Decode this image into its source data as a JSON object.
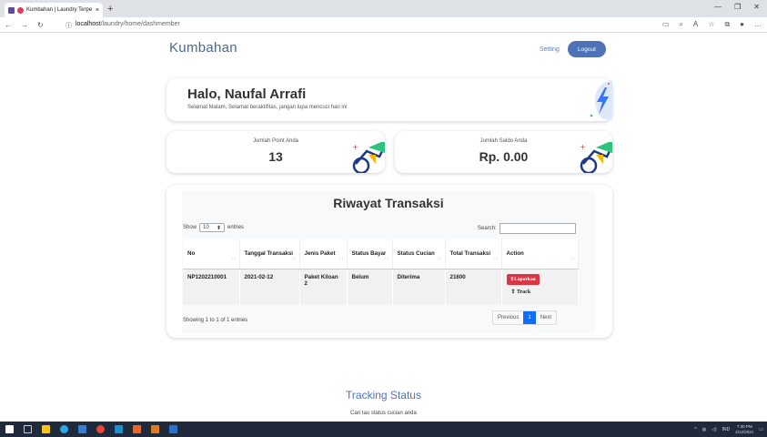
{
  "browser": {
    "tab_title": "Kumbahan | Laundry Terpe",
    "tab_close": "×",
    "new_tab": "+",
    "url_host": "localhost",
    "url_path": "/laundry/home/dashmember"
  },
  "header": {
    "brand": "Kumbahan",
    "setting_label": "Setting",
    "logout_label": "Logout"
  },
  "greeting": {
    "title": "Halo, Naufal Arrafi",
    "subtitle": "Selamat Malam, Selamat beraktifitas, jangan lupa mencuci hari ini"
  },
  "stats": [
    {
      "label": "Jumlah Point Anda",
      "value": "13"
    },
    {
      "label": "Jumlah Saldo Anda",
      "value": "Rp. 0.00"
    }
  ],
  "transactions": {
    "title": "Riwayat Transaksi",
    "show_label": "Show",
    "entries_value": "10",
    "entries_label": "entries",
    "search_label": "Search:",
    "columns": [
      "No",
      "Tanggal Transaksi",
      "Jenis Paket",
      "Status Bayar",
      "Status Cucian",
      "Total Transaksi",
      "Action"
    ],
    "rows": [
      {
        "no": "NP1202210001",
        "tanggal": "2021-02-12",
        "paket": "Paket Kiloan 2",
        "bayar": "Belum",
        "cucian": "Diterima",
        "total": "21600",
        "laporkan": "Laporkan",
        "track": "Track"
      }
    ],
    "info": "Showing 1 to 1 of 1 entries",
    "pager": {
      "prev": "Previous",
      "current": "1",
      "next": "Next"
    }
  },
  "tracking": {
    "title": "Tracking Status",
    "subtitle": "Cari tau status cucian anda"
  },
  "taskbar": {
    "lang": "IND",
    "time": "7:30 PM",
    "date": "2/12/2021"
  },
  "colors": {
    "brand": "#506690",
    "logout_bg": "#4e72b8",
    "laporkan_bg": "#dc3545",
    "pager_active": "#0d6efd"
  }
}
